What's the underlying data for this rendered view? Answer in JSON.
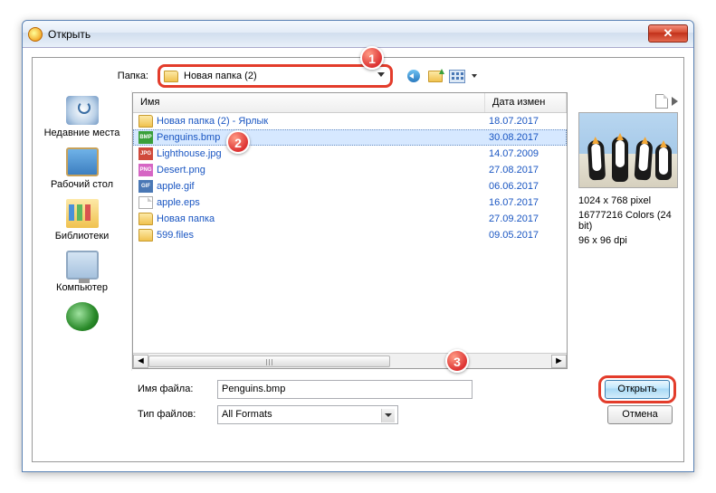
{
  "window": {
    "title": "Открыть"
  },
  "folder": {
    "label": "Папка:",
    "value": "Новая папка (2)"
  },
  "places": {
    "recent": "Недавние места",
    "desktop": "Рабочий стол",
    "libraries": "Библиотеки",
    "computer": "Компьютер",
    "network": ""
  },
  "columns": {
    "name": "Имя",
    "date": "Дата измен"
  },
  "files": [
    {
      "name": "Новая папка (2) - Ярлык",
      "date": "18.07.2017",
      "icon": "folder"
    },
    {
      "name": "Penguins.bmp",
      "date": "30.08.2017",
      "icon": "bmp",
      "selected": true
    },
    {
      "name": "Lighthouse.jpg",
      "date": "14.07.2009",
      "icon": "jpg"
    },
    {
      "name": "Desert.png",
      "date": "27.08.2017",
      "icon": "png"
    },
    {
      "name": "apple.gif",
      "date": "06.06.2017",
      "icon": "gif"
    },
    {
      "name": "apple.eps",
      "date": "16.07.2017",
      "icon": "eps"
    },
    {
      "name": "Новая папка",
      "date": "27.09.2017",
      "icon": "folder"
    },
    {
      "name": "599.files",
      "date": "09.05.2017",
      "icon": "folder"
    }
  ],
  "preview": {
    "dimensions": "1024 x 768 pixel",
    "colors": "16777216 Colors (24 bit)",
    "dpi": "96 x 96 dpi"
  },
  "filename": {
    "label": "Имя файла:",
    "value": "Penguins.bmp"
  },
  "filetype": {
    "label": "Тип файлов:",
    "value": "All Formats"
  },
  "buttons": {
    "open": "Открыть",
    "cancel": "Отмена"
  },
  "callouts": {
    "c1": "1",
    "c2": "2",
    "c3": "3"
  },
  "iconlabels": {
    "bmp": "BMP",
    "jpg": "JPG",
    "png": "PNG",
    "gif": "GIF"
  }
}
